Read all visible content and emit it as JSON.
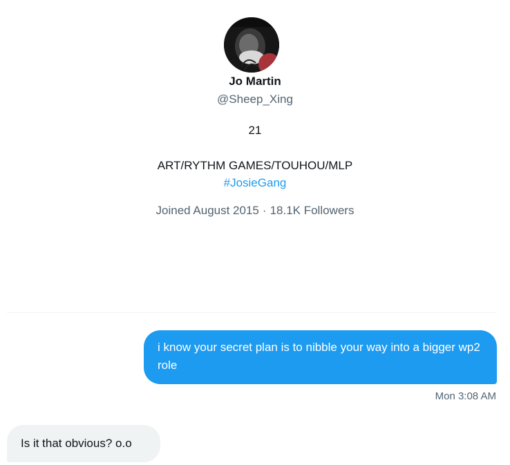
{
  "profile": {
    "avatar_icon": "profile-avatar-photo",
    "name": "Jo Martin",
    "handle": "@Sheep_Xing",
    "bio_line1": "21",
    "bio_line2": "ART/RYTHM GAMES/TOUHOU/MLP",
    "hashtag": "#JosieGang",
    "joined": "Joined August 2015",
    "separator": "·",
    "followers": "18.1K Followers"
  },
  "conversation": {
    "messages": [
      {
        "direction": "sent",
        "text": "i know your secret plan is to nibble your way into a bigger wp2 role",
        "timestamp": "Mon 3:08 AM"
      },
      {
        "direction": "received",
        "text": "Is it that obvious? o.o"
      }
    ]
  },
  "colors": {
    "accent": "#1d9bf0",
    "secondary_text": "#536471",
    "received_bubble": "#eff3f4",
    "divider": "#eff3f4"
  }
}
